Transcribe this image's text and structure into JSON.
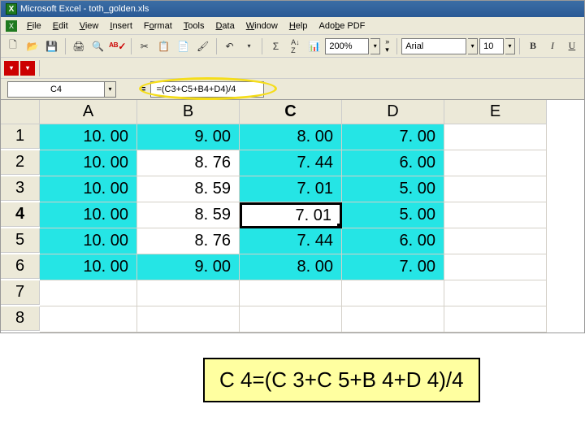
{
  "title": "Microsoft Excel - toth_golden.xls",
  "menus": [
    "File",
    "Edit",
    "View",
    "Insert",
    "Format",
    "Tools",
    "Data",
    "Window",
    "Help",
    "Adobe PDF"
  ],
  "toolbar": {
    "zoom": "200%",
    "font": "Arial",
    "size": "10"
  },
  "namebox": "C4",
  "formula": "=(C3+C5+B4+D4)/4",
  "columns": [
    "A",
    "B",
    "C",
    "D",
    "E"
  ],
  "selected_col": "C",
  "rows": [
    "1",
    "2",
    "3",
    "4",
    "5",
    "6",
    "7",
    "8"
  ],
  "selected_row": "4",
  "cells": {
    "r1": {
      "A": "10. 00",
      "B": "9. 00",
      "C": "8. 00",
      "D": "7. 00",
      "E": ""
    },
    "r2": {
      "A": "10. 00",
      "B": "8. 76",
      "C": "7. 44",
      "D": "6. 00",
      "E": ""
    },
    "r3": {
      "A": "10. 00",
      "B": "8. 59",
      "C": "7. 01",
      "D": "5. 00",
      "E": ""
    },
    "r4": {
      "A": "10. 00",
      "B": "8. 59",
      "C": "7. 01",
      "D": "5. 00",
      "E": ""
    },
    "r5": {
      "A": "10. 00",
      "B": "8. 76",
      "C": "7. 44",
      "D": "6. 00",
      "E": ""
    },
    "r6": {
      "A": "10. 00",
      "B": "9. 00",
      "C": "8. 00",
      "D": "7. 00",
      "E": ""
    },
    "r7": {
      "A": "",
      "B": "",
      "C": "",
      "D": "",
      "E": ""
    },
    "r8": {
      "A": "",
      "B": "",
      "C": "",
      "D": "",
      "E": ""
    }
  },
  "callout": "C 4=(C 3+C 5+B 4+D 4)/4",
  "icons": {
    "new": "🗋",
    "open": "📂",
    "save": "💾",
    "print": "🖨",
    "preview": "🔍",
    "spell": "✓",
    "cut": "✂",
    "copy": "📋",
    "paste": "📄",
    "fmt": "🖌",
    "undo": "↶",
    "sum": "Σ",
    "sort": "A↓Z",
    "chart": "📊"
  }
}
